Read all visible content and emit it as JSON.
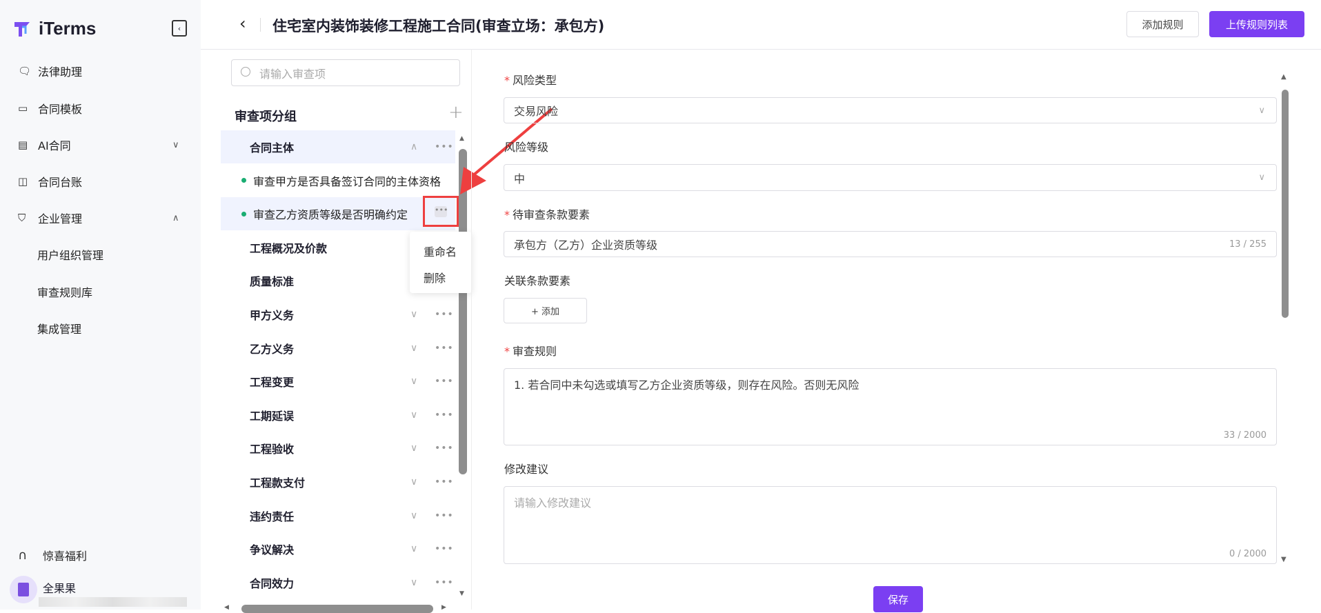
{
  "app": {
    "name": "iTerms"
  },
  "sidebar": {
    "items": [
      {
        "label": "法律助理",
        "icon": "chat-icon"
      },
      {
        "label": "合同模板",
        "icon": "archive-icon"
      },
      {
        "label": "AI合同",
        "icon": "document-icon",
        "chevron": "down"
      },
      {
        "label": "合同台账",
        "icon": "book-icon"
      },
      {
        "label": "企业管理",
        "icon": "shield-icon",
        "chevron": "up"
      },
      {
        "label": "用户组织管理"
      },
      {
        "label": "审查规则库"
      },
      {
        "label": "集成管理"
      }
    ],
    "bottom": {
      "benefit": "惊喜福利",
      "user": "全果果"
    }
  },
  "header": {
    "title": "住宅室内装饰装修工程施工合同(审查立场：承包方)",
    "add_rule": "添加规则",
    "upload_list": "上传规则列表"
  },
  "groups": {
    "search_placeholder": "请输入审查项",
    "title": "审查项分组",
    "rows": [
      {
        "label": "合同主体",
        "type": "group",
        "expanded": true
      },
      {
        "label": "审查甲方是否具备签订合同的主体资格",
        "type": "item"
      },
      {
        "label": "审查乙方资质等级是否明确约定",
        "type": "item"
      },
      {
        "label": "工程概况及价款",
        "type": "group"
      },
      {
        "label": "质量标准",
        "type": "group"
      },
      {
        "label": "甲方义务",
        "type": "group"
      },
      {
        "label": "乙方义务",
        "type": "group"
      },
      {
        "label": "工程变更",
        "type": "group"
      },
      {
        "label": "工期延误",
        "type": "group"
      },
      {
        "label": "工程验收",
        "type": "group"
      },
      {
        "label": "工程款支付",
        "type": "group"
      },
      {
        "label": "违约责任",
        "type": "group"
      },
      {
        "label": "争议解决",
        "type": "group"
      },
      {
        "label": "合同效力",
        "type": "group"
      }
    ],
    "menu": {
      "rename": "重命名",
      "delete": "删除"
    }
  },
  "form": {
    "risk_type": {
      "label": "风险类型",
      "value": "交易风险"
    },
    "risk_level": {
      "label": "风险等级",
      "value": "中"
    },
    "clause": {
      "label": "待审查条款要素",
      "value": "承包方（乙方）企业资质等级",
      "count": "13 / 255"
    },
    "related": {
      "label": "关联条款要素",
      "add": "+ 添加"
    },
    "rule": {
      "label": "审查规则",
      "value": "1. 若合同中未勾选或填写乙方企业资质等级，则存在风险。否则无风险",
      "count": "33 / 2000"
    },
    "suggestion": {
      "label": "修改建议",
      "placeholder": "请输入修改建议",
      "count": "0 / 2000"
    },
    "save": "保存"
  },
  "colors": {
    "accent": "#7b3ff2",
    "annotation": "#ee3f3f",
    "dot": "#1aad72"
  }
}
